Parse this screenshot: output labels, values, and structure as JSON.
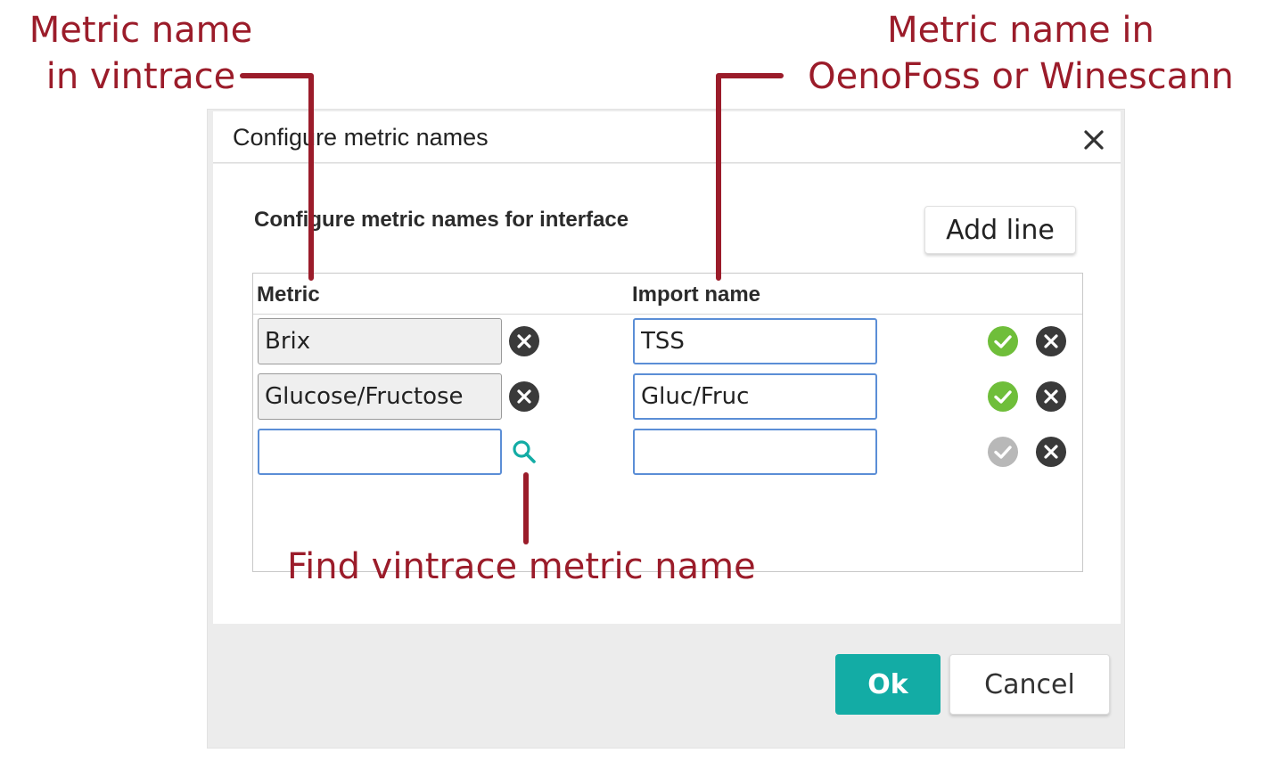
{
  "annotations": {
    "metric_vintrace_line1": "Metric name",
    "metric_vintrace_line2": "in vintrace",
    "metric_external_line1": "Metric name in",
    "metric_external_line2": "OenoFoss or Winescann",
    "find_metric": "Find vintrace metric name",
    "color": "#9b1c2a"
  },
  "dialog": {
    "title": "Configure metric names",
    "close_icon": "close-icon",
    "section_title": "Configure metric names for interface",
    "add_line_label": "Add line",
    "columns": {
      "metric": "Metric",
      "import_name": "Import name"
    },
    "rows": [
      {
        "metric": "Brix",
        "import_name": "TSS",
        "metric_editable": false,
        "accepted": true
      },
      {
        "metric": "Glucose/Fructose",
        "import_name": "Gluc/Fruc",
        "metric_editable": false,
        "accepted": true
      },
      {
        "metric": "",
        "import_name": "",
        "metric_editable": true,
        "accepted": false
      }
    ],
    "ok_label": "Ok",
    "cancel_label": "Cancel",
    "colors": {
      "ok_button": "#13aca5",
      "accept_active": "#6fbe3a",
      "accept_inactive": "#b8b8b8",
      "remove": "#3a3a3a",
      "search": "#13aca5",
      "input_focus_border": "#5b8ed6"
    }
  }
}
